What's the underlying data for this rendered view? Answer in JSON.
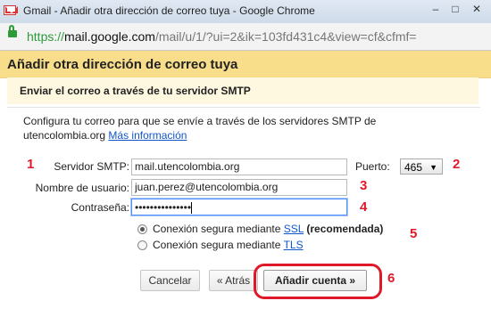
{
  "window": {
    "title": "Gmail - Añadir otra dirección de correo tuya - Google Chrome",
    "url_scheme": "https://",
    "url_host": "mail.google.com",
    "url_path": "/mail/u/1/?ui=2&ik=103fd431c4&view=cf&cfmf="
  },
  "dialog": {
    "title": "Añadir otra dirección de correo tuya",
    "subtitle": "Enviar el correo a través de tu servidor SMTP",
    "description": "Configura tu correo para que se envíe a través de los servidores SMTP de utencolombia.org",
    "more_info_link": "Más información"
  },
  "form": {
    "smtp_label": "Servidor SMTP:",
    "smtp_value": "mail.utencolombia.org",
    "port_label": "Puerto:",
    "port_value": "465",
    "username_label": "Nombre de usuario:",
    "username_value": "juan.perez@utencolombia.org",
    "password_label": "Contraseña:",
    "password_value": "•••••••••••••••",
    "ssl_prefix": "Conexión segura mediante",
    "ssl_link": "SSL",
    "ssl_suffix": "(recomendada)",
    "ssl_selected": true,
    "tls_prefix": "Conexión segura mediante",
    "tls_link": "TLS"
  },
  "buttons": {
    "cancel": "Cancelar",
    "back": "« Atrás",
    "add_account": "Añadir cuenta »"
  },
  "annotations": [
    "1",
    "2",
    "3",
    "4",
    "5",
    "6"
  ],
  "colors": {
    "header_bg": "#f8dd8a",
    "annotation_red": "#e0192a",
    "link_blue": "#1155cc"
  }
}
